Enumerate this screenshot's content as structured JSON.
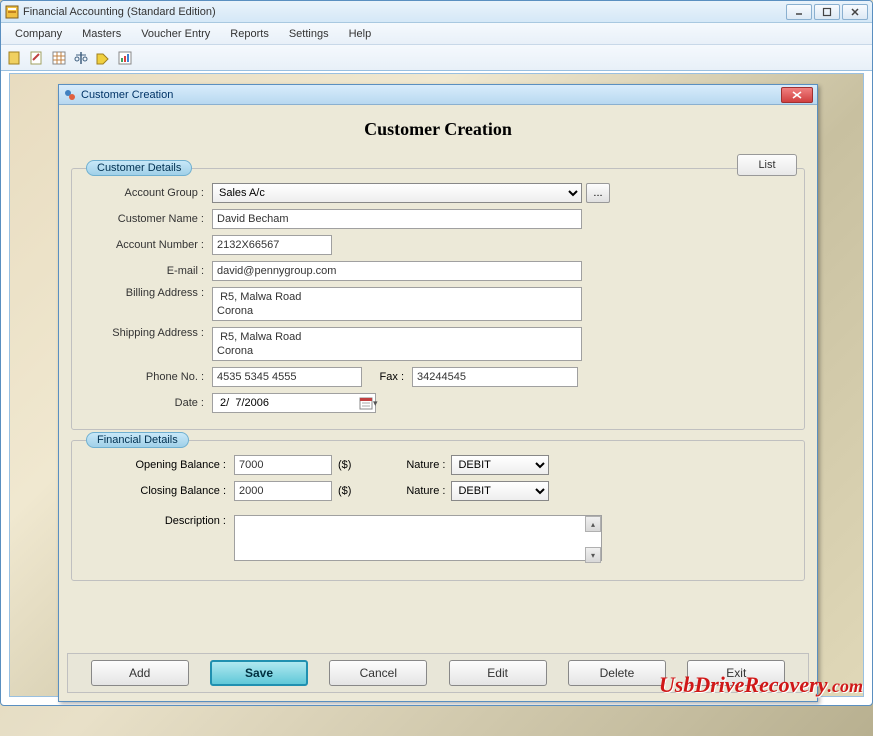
{
  "appWindow": {
    "title": "Financial Accounting (Standard Edition)"
  },
  "menu": [
    "Company",
    "Masters",
    "Voucher Entry",
    "Reports",
    "Settings",
    "Help"
  ],
  "dialog": {
    "windowTitle": "Customer Creation",
    "heading": "Customer Creation",
    "listBtn": "List",
    "section1": "Customer Details",
    "section2": "Financial Details",
    "labels": {
      "accountGroup": "Account Group :",
      "customerName": "Customer Name :",
      "accountNumber": "Account Number :",
      "email": "E-mail :",
      "billingAddress": "Billing Address :",
      "shippingAddress": "Shipping Address :",
      "phone": "Phone No. :",
      "fax": "Fax :",
      "date": "Date :",
      "openingBalance": "Opening Balance :",
      "closingBalance": "Closing Balance :",
      "currency": "($)",
      "nature": "Nature :",
      "description": "Description :"
    },
    "values": {
      "accountGroup": "Sales A/c",
      "customerName": "David Becham",
      "accountNumber": "2132X66567",
      "email": "david@pennygroup.com",
      "billingAddress": " R5, Malwa Road\nCorona",
      "shippingAddress": " R5, Malwa Road\nCorona",
      "phone": "4535 5345 4555",
      "fax": "34244545",
      "date": " 2/  7/2006",
      "openingBalance": "7000",
      "closingBalance": "2000",
      "nature1": "DEBIT",
      "nature2": "DEBIT",
      "description": ""
    },
    "browseBtn": "..."
  },
  "buttons": {
    "add": "Add",
    "save": "Save",
    "cancel": "Cancel",
    "edit": "Edit",
    "delete": "Delete",
    "exit": "Exit"
  },
  "watermark": {
    "main": "UsbDriveRecovery",
    "suffix": ".com"
  }
}
